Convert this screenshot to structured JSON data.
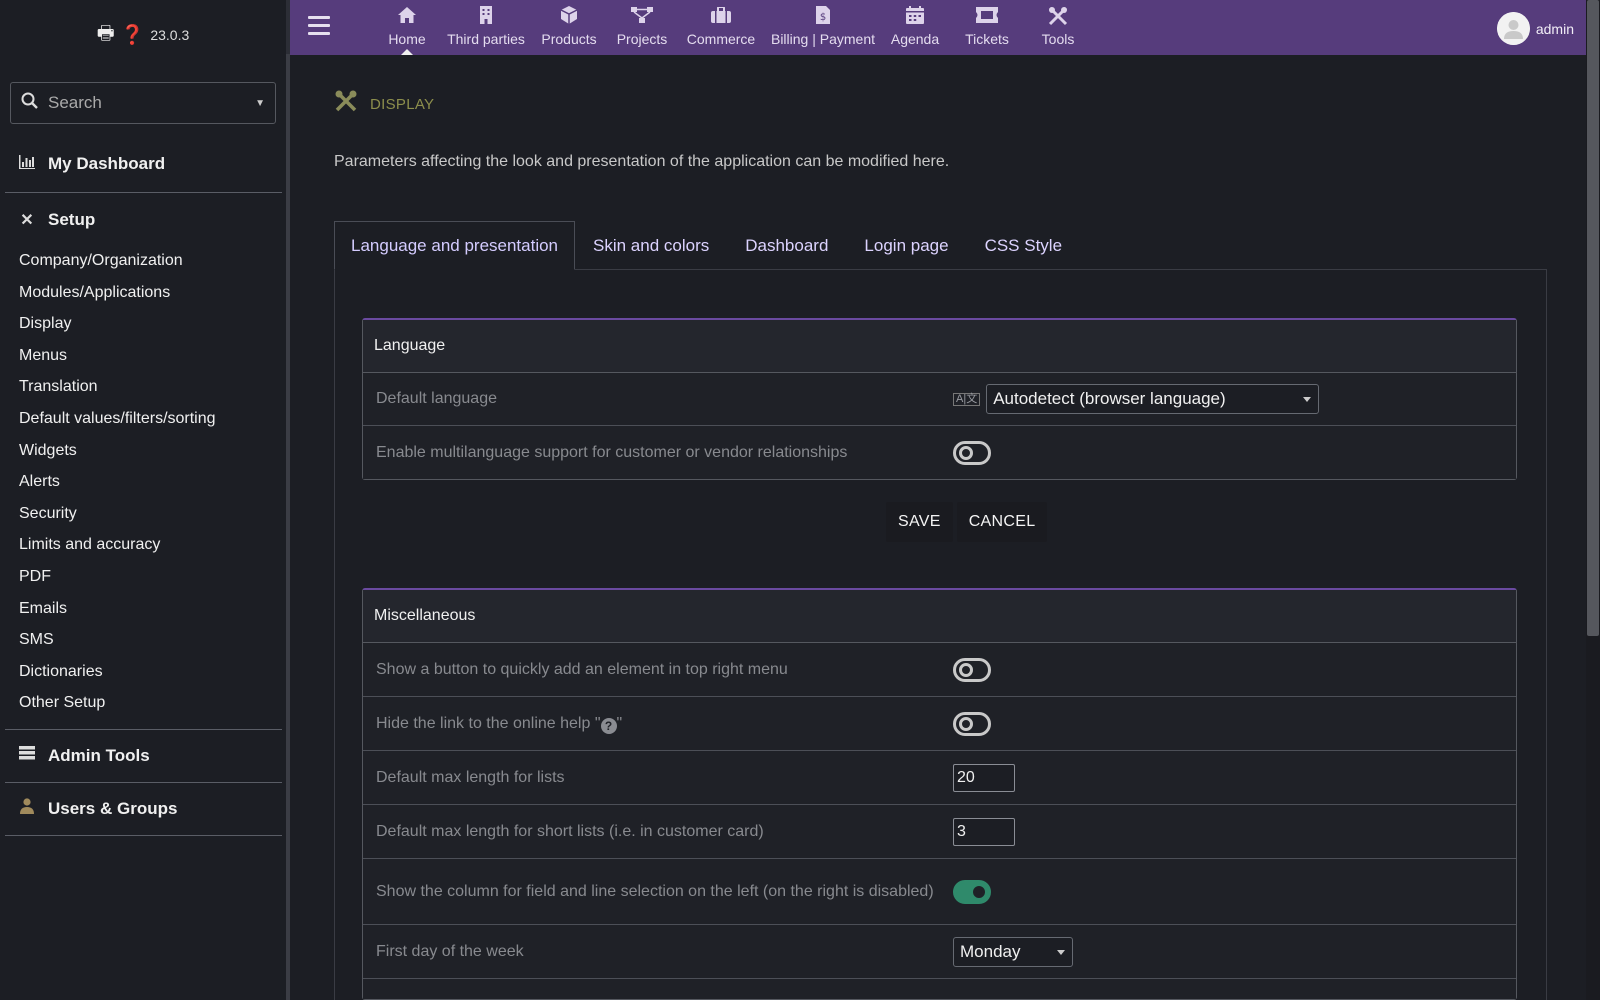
{
  "app": {
    "version": "23.0.3"
  },
  "search": {
    "placeholder": "Search"
  },
  "sidebar": {
    "dashboard": "My Dashboard",
    "setup": "Setup",
    "setup_items": [
      "Company/Organization",
      "Modules/Applications",
      "Display",
      "Menus",
      "Translation",
      "Default values/filters/sorting",
      "Widgets",
      "Alerts",
      "Security",
      "Limits and accuracy",
      "PDF",
      "Emails",
      "SMS",
      "Dictionaries",
      "Other Setup"
    ],
    "admin_tools": "Admin Tools",
    "users_groups": "Users & Groups"
  },
  "topnav": {
    "items": [
      {
        "label": "Home",
        "icon": "home-icon",
        "active": true
      },
      {
        "label": "Third parties",
        "icon": "building-icon"
      },
      {
        "label": "Products",
        "icon": "cube-icon"
      },
      {
        "label": "Projects",
        "icon": "project-icon"
      },
      {
        "label": "Commerce",
        "icon": "suitcase-icon"
      },
      {
        "label": "Billing | Payment",
        "icon": "invoice-icon"
      },
      {
        "label": "Agenda",
        "icon": "calendar-icon"
      },
      {
        "label": "Tickets",
        "icon": "ticket-icon"
      },
      {
        "label": "Tools",
        "icon": "tools-icon"
      }
    ],
    "user": "admin"
  },
  "page": {
    "title": "DISPLAY",
    "description": "Parameters affecting the look and presentation of the application can be modified here."
  },
  "tabs": [
    {
      "label": "Language and presentation",
      "active": true
    },
    {
      "label": "Skin and colors"
    },
    {
      "label": "Dashboard"
    },
    {
      "label": "Login page"
    },
    {
      "label": "CSS Style"
    }
  ],
  "language_box": {
    "title": "Language",
    "default_language_label": "Default language",
    "default_language_value": "Autodetect (browser language)",
    "multilang_label": "Enable multilanguage support for customer or vendor relationships",
    "multilang_on": false
  },
  "buttons": {
    "save": "SAVE",
    "cancel": "CANCEL"
  },
  "misc_box": {
    "title": "Miscellaneous",
    "quick_add_label": "Show a button to quickly add an element in top right menu",
    "quick_add_on": false,
    "hide_help_label": "Hide the link to the online help \"",
    "hide_help_suffix": "\"",
    "hide_help_on": false,
    "max_list_label": "Default max length for lists",
    "max_list_value": "20",
    "max_short_label": "Default max length for short lists (i.e. in customer card)",
    "max_short_value": "3",
    "selection_col_label": "Show the column for field and line selection on the left (on the right is disabled)",
    "selection_col_on": true,
    "first_day_label": "First day of the week",
    "first_day_value": "Monday"
  },
  "colors": {
    "topbar": "#563c7c",
    "accent_toggle": "#2f8a6b",
    "title": "#8c8e4c",
    "tab_text": "#dcd3ff"
  }
}
